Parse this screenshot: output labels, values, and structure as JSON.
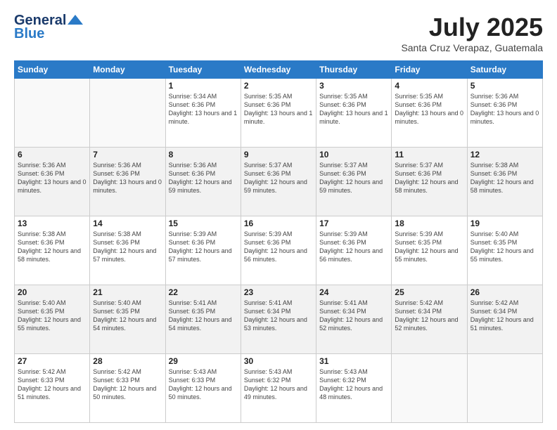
{
  "header": {
    "logo_line1": "General",
    "logo_line2": "Blue",
    "month": "July 2025",
    "location": "Santa Cruz Verapaz, Guatemala"
  },
  "days_of_week": [
    "Sunday",
    "Monday",
    "Tuesday",
    "Wednesday",
    "Thursday",
    "Friday",
    "Saturday"
  ],
  "weeks": [
    [
      {
        "day": "",
        "info": ""
      },
      {
        "day": "",
        "info": ""
      },
      {
        "day": "1",
        "info": "Sunrise: 5:34 AM\nSunset: 6:36 PM\nDaylight: 13 hours and 1 minute."
      },
      {
        "day": "2",
        "info": "Sunrise: 5:35 AM\nSunset: 6:36 PM\nDaylight: 13 hours and 1 minute."
      },
      {
        "day": "3",
        "info": "Sunrise: 5:35 AM\nSunset: 6:36 PM\nDaylight: 13 hours and 1 minute."
      },
      {
        "day": "4",
        "info": "Sunrise: 5:35 AM\nSunset: 6:36 PM\nDaylight: 13 hours and 0 minutes."
      },
      {
        "day": "5",
        "info": "Sunrise: 5:36 AM\nSunset: 6:36 PM\nDaylight: 13 hours and 0 minutes."
      }
    ],
    [
      {
        "day": "6",
        "info": "Sunrise: 5:36 AM\nSunset: 6:36 PM\nDaylight: 13 hours and 0 minutes."
      },
      {
        "day": "7",
        "info": "Sunrise: 5:36 AM\nSunset: 6:36 PM\nDaylight: 13 hours and 0 minutes."
      },
      {
        "day": "8",
        "info": "Sunrise: 5:36 AM\nSunset: 6:36 PM\nDaylight: 12 hours and 59 minutes."
      },
      {
        "day": "9",
        "info": "Sunrise: 5:37 AM\nSunset: 6:36 PM\nDaylight: 12 hours and 59 minutes."
      },
      {
        "day": "10",
        "info": "Sunrise: 5:37 AM\nSunset: 6:36 PM\nDaylight: 12 hours and 59 minutes."
      },
      {
        "day": "11",
        "info": "Sunrise: 5:37 AM\nSunset: 6:36 PM\nDaylight: 12 hours and 58 minutes."
      },
      {
        "day": "12",
        "info": "Sunrise: 5:38 AM\nSunset: 6:36 PM\nDaylight: 12 hours and 58 minutes."
      }
    ],
    [
      {
        "day": "13",
        "info": "Sunrise: 5:38 AM\nSunset: 6:36 PM\nDaylight: 12 hours and 58 minutes."
      },
      {
        "day": "14",
        "info": "Sunrise: 5:38 AM\nSunset: 6:36 PM\nDaylight: 12 hours and 57 minutes."
      },
      {
        "day": "15",
        "info": "Sunrise: 5:39 AM\nSunset: 6:36 PM\nDaylight: 12 hours and 57 minutes."
      },
      {
        "day": "16",
        "info": "Sunrise: 5:39 AM\nSunset: 6:36 PM\nDaylight: 12 hours and 56 minutes."
      },
      {
        "day": "17",
        "info": "Sunrise: 5:39 AM\nSunset: 6:36 PM\nDaylight: 12 hours and 56 minutes."
      },
      {
        "day": "18",
        "info": "Sunrise: 5:39 AM\nSunset: 6:35 PM\nDaylight: 12 hours and 55 minutes."
      },
      {
        "day": "19",
        "info": "Sunrise: 5:40 AM\nSunset: 6:35 PM\nDaylight: 12 hours and 55 minutes."
      }
    ],
    [
      {
        "day": "20",
        "info": "Sunrise: 5:40 AM\nSunset: 6:35 PM\nDaylight: 12 hours and 55 minutes."
      },
      {
        "day": "21",
        "info": "Sunrise: 5:40 AM\nSunset: 6:35 PM\nDaylight: 12 hours and 54 minutes."
      },
      {
        "day": "22",
        "info": "Sunrise: 5:41 AM\nSunset: 6:35 PM\nDaylight: 12 hours and 54 minutes."
      },
      {
        "day": "23",
        "info": "Sunrise: 5:41 AM\nSunset: 6:34 PM\nDaylight: 12 hours and 53 minutes."
      },
      {
        "day": "24",
        "info": "Sunrise: 5:41 AM\nSunset: 6:34 PM\nDaylight: 12 hours and 52 minutes."
      },
      {
        "day": "25",
        "info": "Sunrise: 5:42 AM\nSunset: 6:34 PM\nDaylight: 12 hours and 52 minutes."
      },
      {
        "day": "26",
        "info": "Sunrise: 5:42 AM\nSunset: 6:34 PM\nDaylight: 12 hours and 51 minutes."
      }
    ],
    [
      {
        "day": "27",
        "info": "Sunrise: 5:42 AM\nSunset: 6:33 PM\nDaylight: 12 hours and 51 minutes."
      },
      {
        "day": "28",
        "info": "Sunrise: 5:42 AM\nSunset: 6:33 PM\nDaylight: 12 hours and 50 minutes."
      },
      {
        "day": "29",
        "info": "Sunrise: 5:43 AM\nSunset: 6:33 PM\nDaylight: 12 hours and 50 minutes."
      },
      {
        "day": "30",
        "info": "Sunrise: 5:43 AM\nSunset: 6:32 PM\nDaylight: 12 hours and 49 minutes."
      },
      {
        "day": "31",
        "info": "Sunrise: 5:43 AM\nSunset: 6:32 PM\nDaylight: 12 hours and 48 minutes."
      },
      {
        "day": "",
        "info": ""
      },
      {
        "day": "",
        "info": ""
      }
    ]
  ]
}
